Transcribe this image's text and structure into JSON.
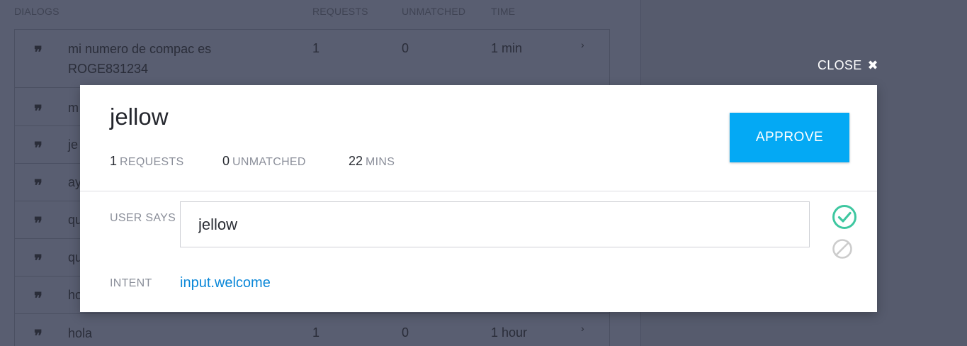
{
  "background_table": {
    "headers": {
      "dialogs": "DIALOGS",
      "requests": "REQUESTS",
      "unmatched": "UNMATCHED",
      "time": "TIME"
    },
    "rows": [
      {
        "text": "mi numero de compac es ROGE831234",
        "text_line1": "mi numero de compac es",
        "text_line2": "ROGE831234",
        "requests": "1",
        "unmatched": "0",
        "time": "1 min",
        "chevron": "›"
      },
      {
        "text_visible": "m"
      },
      {
        "text_visible": "je"
      },
      {
        "text_visible": "ay"
      },
      {
        "text_visible": "qu"
      },
      {
        "text_visible": "qu"
      },
      {
        "text_visible": "ho"
      },
      {
        "text": "hola",
        "requests": "1",
        "unmatched": "0",
        "time": "1 hour",
        "chevron": "›"
      }
    ],
    "quote_glyph": "❞"
  },
  "close": {
    "label": "CLOSE",
    "icon": "✖"
  },
  "modal": {
    "title": "jellow",
    "stats": [
      {
        "value": "1",
        "unit": "REQUESTS"
      },
      {
        "value": "0",
        "unit": "UNMATCHED"
      },
      {
        "value": "22",
        "unit": "MINS"
      }
    ],
    "approve_label": "APPROVE",
    "user_says_label": "USER SAYS",
    "user_says_value": "jellow",
    "intent_label": "INTENT",
    "intent_value": "input.welcome"
  },
  "colors": {
    "accent": "#04a9f4",
    "link": "#0a87d8",
    "check": "#3ec7a0",
    "block": "#cccccc"
  }
}
